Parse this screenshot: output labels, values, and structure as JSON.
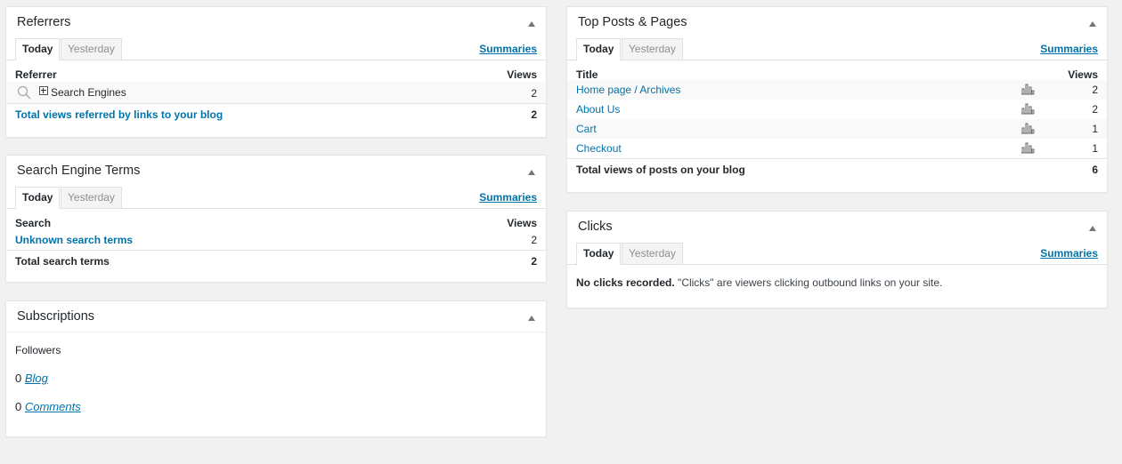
{
  "common": {
    "tab_today": "Today",
    "tab_yesterday": "Yesterday",
    "summaries": "Summaries"
  },
  "referrers": {
    "title": "Referrers",
    "col_left": "Referrer",
    "col_right": "Views",
    "rows": [
      {
        "label": "Search Engines",
        "views": "2"
      }
    ],
    "total_label": "Total views referred by links to your blog",
    "total_value": "2"
  },
  "search_terms": {
    "title": "Search Engine Terms",
    "col_left": "Search",
    "col_right": "Views",
    "rows": [
      {
        "label": "Unknown search terms",
        "views": "2"
      }
    ],
    "total_label": "Total search terms",
    "total_value": "2"
  },
  "subscriptions": {
    "title": "Subscriptions",
    "followers_label": "Followers",
    "items": [
      {
        "count": "0",
        "label": "Blog"
      },
      {
        "count": "0",
        "label": "Comments"
      }
    ]
  },
  "top_posts": {
    "title": "Top Posts & Pages",
    "col_left": "Title",
    "col_right": "Views",
    "rows": [
      {
        "label": "Home page / Archives",
        "views": "2"
      },
      {
        "label": "About Us",
        "views": "2"
      },
      {
        "label": "Cart",
        "views": "1"
      },
      {
        "label": "Checkout",
        "views": "1"
      }
    ],
    "total_label": "Total views of posts on your blog",
    "total_value": "6"
  },
  "clicks": {
    "title": "Clicks",
    "message_bold": "No clicks recorded.",
    "message_rest": " \"Clicks\" are viewers clicking outbound links on your site."
  },
  "colors": {
    "link": "#0073aa",
    "background": "#f1f1f1",
    "text": "#23282d"
  },
  "icons": {
    "toggle": "triangle-up-icon",
    "search": "magnifier-icon",
    "expand": "plus-box-icon",
    "stats": "bar-chart-icon"
  }
}
